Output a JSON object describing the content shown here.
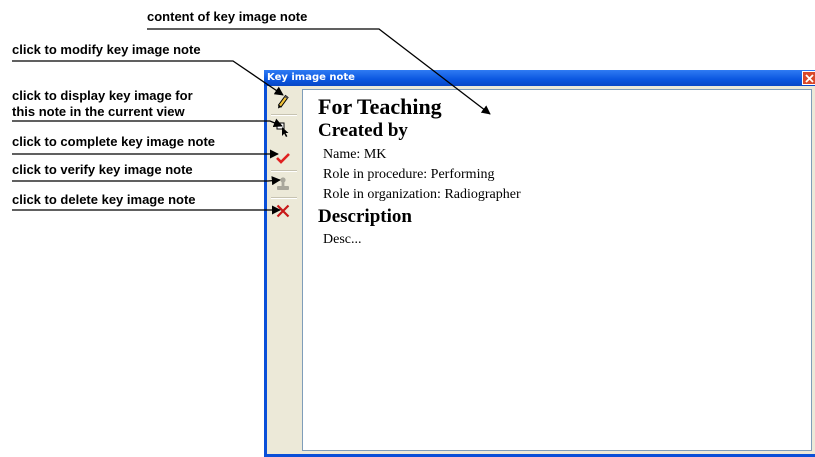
{
  "callouts": {
    "content": "content of key image note",
    "modify": "click to modify key image note",
    "display_line1": "click to display key image for",
    "display_line2": "this note in the current view",
    "complete": "click to complete key image note",
    "verify": "click to verify key image note",
    "delete": "click to delete key image note"
  },
  "window": {
    "title": "Key image note",
    "close_icon": "close-icon"
  },
  "toolbar": {
    "items": [
      {
        "name": "modify-button",
        "icon": "pencil-icon"
      },
      {
        "name": "display-button",
        "icon": "display-image-icon"
      },
      {
        "name": "complete-button",
        "icon": "checkmark-icon"
      },
      {
        "name": "verify-button",
        "icon": "stamp-icon"
      },
      {
        "name": "delete-button",
        "icon": "delete-x-icon"
      }
    ]
  },
  "note": {
    "title": "For Teaching",
    "created_by_heading": "Created by",
    "name": "Name: MK",
    "role_procedure": "Role in procedure: Performing",
    "role_organization": "Role in organization: Radiographer",
    "description_heading": "Description",
    "description": "Desc..."
  },
  "colors": {
    "title_bar": "#0a56e0",
    "client_bg": "#ece9d8",
    "close_button": "#d9482a",
    "checkmark": "#e02020",
    "delete_x": "#c81818"
  }
}
